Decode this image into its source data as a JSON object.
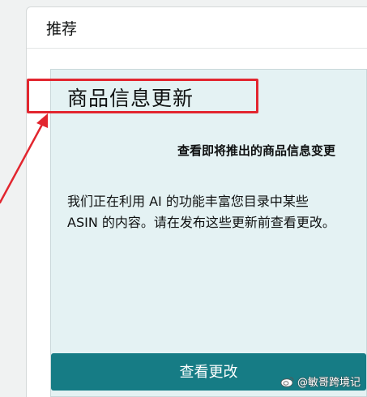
{
  "panel": {
    "title": "推荐"
  },
  "card": {
    "title": "商品信息更新",
    "subtitle": "查看即将推出的商品信息变更",
    "body": "我们正在利用 AI 的功能丰富您目录中某些 ASIN 的内容。请在发布这些更新前查看更改。",
    "button_label": "查看更改"
  },
  "annotation": {
    "color": "#e2262f"
  },
  "watermark": {
    "text": "@敏哥跨境记"
  },
  "colors": {
    "card_background": "#e4f2f3",
    "button": "#167c85",
    "highlight": "#e2262f"
  }
}
